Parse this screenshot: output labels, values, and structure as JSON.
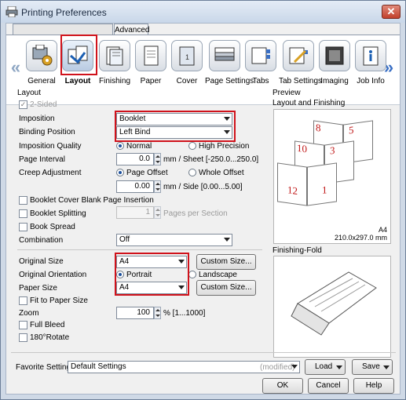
{
  "window": {
    "title": "Printing Preferences",
    "close_glyph": "✕"
  },
  "tabs": {
    "hidden_label": "",
    "advanced": "Advanced"
  },
  "toolbar": {
    "nav_left": "«",
    "nav_right": "»",
    "items": [
      {
        "label": "General",
        "icon": "printer-settings-icon"
      },
      {
        "label": "Layout",
        "icon": "layout-icon"
      },
      {
        "label": "Finishing",
        "icon": "finishing-icon"
      },
      {
        "label": "Paper",
        "icon": "paper-icon"
      },
      {
        "label": "Cover",
        "icon": "cover-icon"
      },
      {
        "label": "Page Settings",
        "icon": "page-settings-icon"
      },
      {
        "label": "Tabs",
        "icon": "tabs-icon"
      },
      {
        "label": "Tab Settings",
        "icon": "tab-settings-icon"
      },
      {
        "label": "Imaging",
        "icon": "imaging-icon"
      },
      {
        "label": "Job Info",
        "icon": "job-info-icon"
      }
    ],
    "selected": "Layout"
  },
  "layout": {
    "group_title": "Layout",
    "two_sided": "2-Sided",
    "imposition_label": "Imposition",
    "imposition_value": "Booklet",
    "binding_label": "Binding Position",
    "binding_value": "Left Bind",
    "quality_label": "Imposition Quality",
    "quality_normal": "Normal",
    "quality_high": "High Precision",
    "page_interval_label": "Page Interval",
    "page_interval_value": "0.0",
    "page_interval_unit": "mm / Sheet [-250.0...250.0]",
    "creep_label": "Creep Adjustment",
    "creep_page_offset": "Page Offset",
    "creep_whole_offset": "Whole Offset",
    "creep_value": "0.00",
    "creep_unit": "mm / Side [0.00...5.00]",
    "blank_insertion": "Booklet Cover Blank Page Insertion",
    "booklet_splitting": "Booklet Splitting",
    "splitting_value": "1",
    "splitting_unit": "Pages per Section",
    "book_spread": "Book Spread",
    "combination_label": "Combination",
    "combination_value": "Off",
    "original_size_label": "Original Size",
    "original_size_value": "A4",
    "custom_size_1": "Custom Size...",
    "orientation_label": "Original Orientation",
    "orientation_portrait": "Portrait",
    "orientation_landscape": "Landscape",
    "paper_size_label": "Paper Size",
    "paper_size_value": "A4",
    "custom_size_2": "Custom Size...",
    "fit_to_paper": "Fit to Paper Size",
    "zoom_label": "Zoom",
    "zoom_value": "100",
    "zoom_unit": "% [1...1000]",
    "full_bleed": "Full Bleed",
    "rotate": "180°Rotate"
  },
  "preview": {
    "group_title": "Preview",
    "layout_title": "Layout and Finishing",
    "page_numbers": [
      "8",
      "5",
      "10",
      "3",
      "12",
      "1"
    ],
    "paper_name": "A4",
    "paper_dims": "210.0x297.0 mm",
    "fold_title": "Finishing-Fold"
  },
  "bottom": {
    "favorite_label": "Favorite Setting",
    "favorite_value": "Default Settings",
    "favorite_state": "(modified)",
    "load": "Load",
    "save": "Save",
    "ok": "OK",
    "cancel": "Cancel",
    "help": "Help"
  },
  "colors": {
    "highlight": "#d0121b",
    "page_number": "#c01717"
  }
}
